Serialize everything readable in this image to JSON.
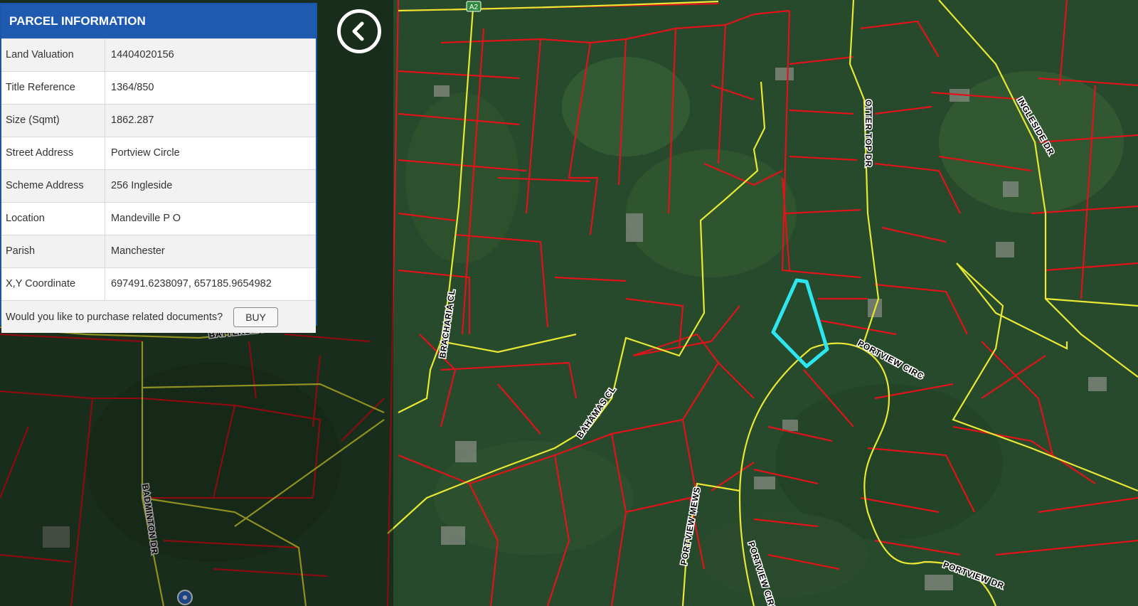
{
  "panel": {
    "title": "PARCEL INFORMATION",
    "rows": [
      {
        "label": "Land Valuation",
        "value": "14404020156"
      },
      {
        "label": "Title Reference",
        "value": "1364/850"
      },
      {
        "label": "Size (Sqmt)",
        "value": "1862.287"
      },
      {
        "label": "Street Address",
        "value": "Portview Circle"
      },
      {
        "label": "Scheme Address",
        "value": "256 Ingleside"
      },
      {
        "label": "Location",
        "value": "Mandeville P O"
      },
      {
        "label": "Parish",
        "value": "Manchester"
      },
      {
        "label": "X,Y Coordinate",
        "value": "697491.6238097,  657185.9654982"
      }
    ],
    "purchase_prompt": "Would you like to purchase related documents?",
    "buy_label": "BUY"
  },
  "back_button": {
    "icon": "chevron-left-icon"
  },
  "map": {
    "highway_shield": "A2",
    "road_labels": {
      "bracharia": "BRACHARIA CL",
      "battersea": "BATTERSEA",
      "badminton": "BADMINTON DR",
      "bahamas": "BAHAMAS CL",
      "otter_top": "OTTER TOP DR",
      "ingleside": "INGLESIDE DR",
      "portview_circ_a": "PORTVIEW CIRC",
      "portview_mews": "PORTVIEW MEWS",
      "portview_circ_b": "PORTVIEW CIRC",
      "portview_dr": "PORTVIEW DR"
    },
    "colors": {
      "parcel_line": "#e0131a",
      "road_line": "#e8e835",
      "selected_parcel": "#2ee6f0",
      "panel_header": "#1e5bb0"
    }
  }
}
